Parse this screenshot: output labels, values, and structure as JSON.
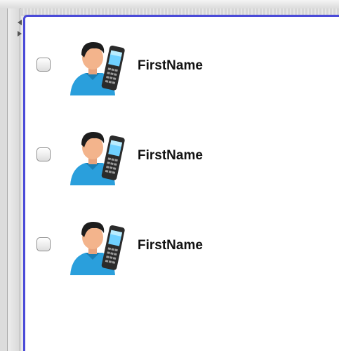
{
  "contacts": {
    "items": [
      {
        "name": "FirstName",
        "checked": false
      },
      {
        "name": "FirstName",
        "checked": false
      },
      {
        "name": "FirstName",
        "checked": false
      }
    ]
  },
  "icons": {
    "splitter_left": "arrow-left-icon",
    "splitter_right": "arrow-right-icon",
    "contact_avatar": "person-with-phone-icon"
  },
  "colors": {
    "panel_border": "#4a4ad8",
    "shirt": "#2a9fdc",
    "skin": "#f3b48c",
    "hair": "#1d1d1d"
  }
}
